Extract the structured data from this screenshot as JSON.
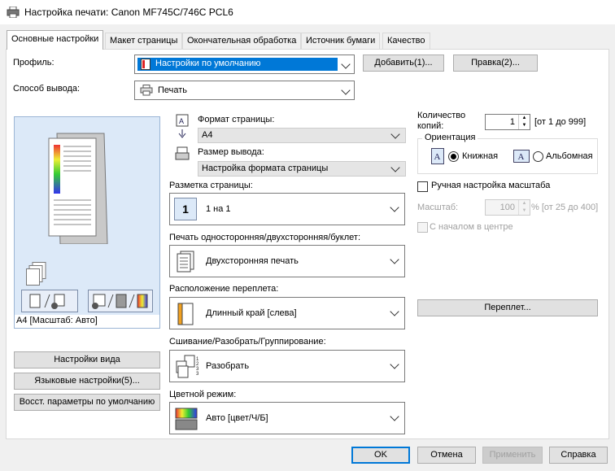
{
  "window": {
    "title": "Настройка печати: Canon MF745C/746C PCL6"
  },
  "tabs": [
    {
      "label": "Основные настройки"
    },
    {
      "label": "Макет страницы"
    },
    {
      "label": "Окончательная обработка"
    },
    {
      "label": "Источник бумаги"
    },
    {
      "label": "Качество"
    }
  ],
  "profile": {
    "label": "Профиль:",
    "value": "Настройки по умолчанию",
    "add_label": "Добавить(1)...",
    "edit_label": "Правка(2)..."
  },
  "output": {
    "label": "Способ вывода:",
    "value": "Печать"
  },
  "preview": {
    "caption": "A4 [Масштаб: Авто]"
  },
  "left_buttons": {
    "view_settings": "Настройки вида",
    "language": "Языковые настройки(5)...",
    "restore": "Восст. параметры по умолчанию"
  },
  "page_size": {
    "label": "Формат страницы:",
    "value": "A4"
  },
  "output_size": {
    "label": "Размер вывода:",
    "value": "Настройка формата страницы"
  },
  "layout": {
    "label": "Разметка страницы:",
    "value": "1 на 1",
    "icon_text": "1"
  },
  "duplex": {
    "label": "Печать односторонняя/двухсторонняя/буклет:",
    "value": "Двухсторонняя печать"
  },
  "binding": {
    "label": "Расположение переплета:",
    "value": "Длинный край [слева]",
    "button": "Переплет..."
  },
  "collate": {
    "label": "Сшивание/Разобрать/Группирование:",
    "value": "Разобрать"
  },
  "color_mode": {
    "label": "Цветной режим:",
    "value": "Авто [цвет/Ч/Б]"
  },
  "copies": {
    "label_line1": "Количество",
    "label_line2": "копий:",
    "value": "1",
    "range": "[от 1 до 999]"
  },
  "orientation": {
    "legend": "Ориентация",
    "portrait": "Книжная",
    "landscape": "Альбомная",
    "selected": "portrait"
  },
  "scaling": {
    "manual_label": "Ручная настройка масштаба",
    "scale_label": "Масштаб:",
    "scale_value": "100",
    "scale_range": "% [от 25 до 400]",
    "center_label": "С началом в центре"
  },
  "footer": {
    "ok": "OK",
    "cancel": "Отмена",
    "apply": "Применить",
    "help": "Справка"
  },
  "colors": {
    "selection": "#0078d7",
    "panel": "#ffffff",
    "preview_bg": "#dce9f8"
  }
}
